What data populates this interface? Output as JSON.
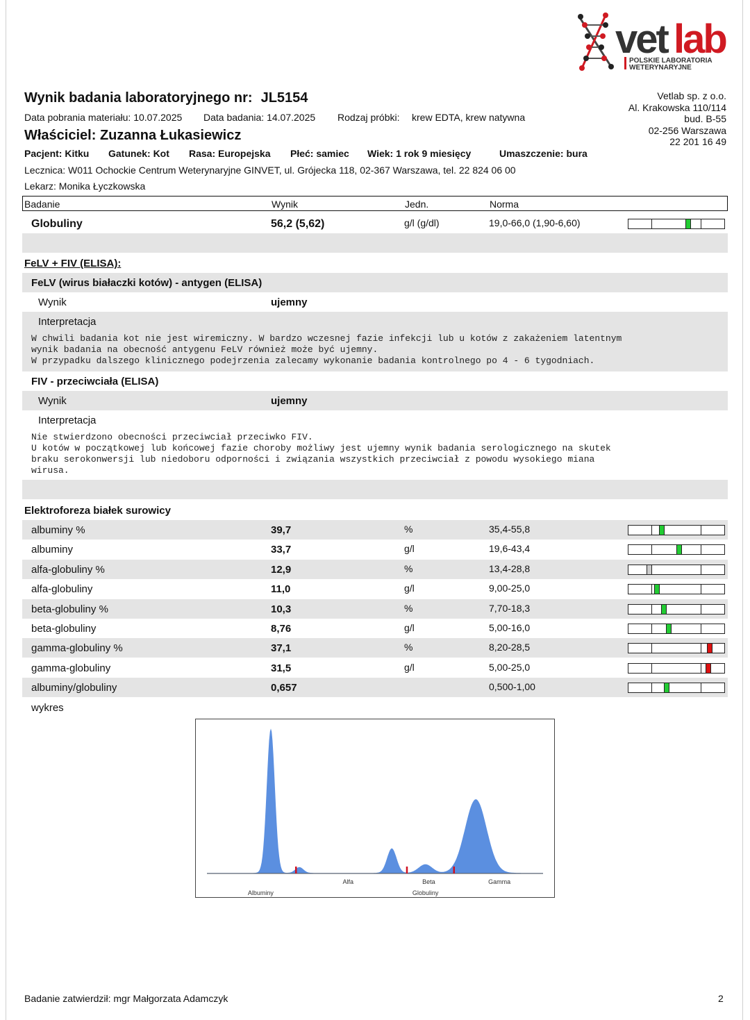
{
  "logo": {
    "brand_a": "vet",
    "brand_b": "lab",
    "line1": "POLSKIE LABORATORIA",
    "line2": "WETERYNARYJNE"
  },
  "report": {
    "title_label": "Wynik badania laboratoryjnego nr:",
    "number": "JL5154",
    "collection_date": "Data pobrania materiału: 10.07.2025",
    "test_date": "Data badania: 14.07.2025",
    "sample_type_label": "Rodzaj próbki:",
    "sample_type": "krew EDTA, krew natywna",
    "owner_label": "Właściciel:",
    "owner": "Zuzanna Łukasiewicz",
    "patient": "Pacjent: Kitku",
    "species": "Gatunek: Kot",
    "breed": "Rasa: Europejska",
    "sex": "Płeć: samiec",
    "age": "Wiek: 1 rok 9 miesięcy",
    "color": "Umaszczenie: bura",
    "clinic": "Lecznica: W011 Ochockie Centrum Weterynaryjne GINVET, ul. Grójecka 118, 02-367 Warszawa, tel. 22 824 06 00",
    "doctor": "Lekarz: Monika Łyczkowska"
  },
  "lab": {
    "name": "Vetlab sp. z o.o.",
    "street": "Al. Krakowska 110/114",
    "building": "bud. B-55",
    "city": "02-256 Warszawa",
    "phone": "22 201 16 49"
  },
  "table_header": {
    "test": "Badanie",
    "result": "Wynik",
    "unit": "Jedn.",
    "norm": "Norma"
  },
  "globulins": {
    "name": "Globuliny",
    "result": "56,2 (5,62)",
    "unit": "g/l (g/dl)",
    "norm": "19,0-66,0 (1,90-6,60)",
    "level": 0.62,
    "status": "normal"
  },
  "felv_fiv": {
    "heading": "FeLV + FIV (ELISA):",
    "felv_title": "FeLV (wirus białaczki kotów) - antygen (ELISA)",
    "felv_result_label": "Wynik",
    "felv_result": "ujemny",
    "felv_interp_label": "Interpretacja",
    "felv_interp": "W chwili badania kot nie jest wiremiczny. W bardzo wczesnej fazie infekcji lub u kotów z zakażeniem latentnym\nwynik badania na obecność antygenu FeLV również może być ujemny.\nW przypadku dalszego klinicznego podejrzenia zalecamy wykonanie badania kontrolnego po 4 - 6 tygodniach.",
    "fiv_title": "FIV - przeciwciała (ELISA)",
    "fiv_result_label": "Wynik",
    "fiv_result": "ujemny",
    "fiv_interp_label": "Interpretacja",
    "fiv_interp": "Nie stwierdzono obecności przeciwciał przeciwko FIV.\nU kotów w początkowej lub końcowej fazie choroby możliwy jest ujemny wynik badania serologicznego na skutek\nbraku serokonwersji lub niedoboru odporności i związania wszystkich przeciwciał z powodu wysokiego miana\nwirusa."
  },
  "electrophoresis": {
    "heading": "Elektroforeza białek surowicy",
    "rows": [
      {
        "name": "albuminy %",
        "result": "39,7",
        "unit": "%",
        "norm": "35,4-55,8",
        "level": 0.35,
        "status": "normal"
      },
      {
        "name": "albuminy",
        "result": "33,7",
        "unit": "g/l",
        "norm": "19,6-43,4",
        "level": 0.53,
        "status": "normal"
      },
      {
        "name": "alfa-globuliny %",
        "result": "12,9",
        "unit": "%",
        "norm": "13,4-28,8",
        "level": 0.22,
        "status": "low"
      },
      {
        "name": "alfa-globuliny",
        "result": "11,0",
        "unit": "g/l",
        "norm": "9,00-25,0",
        "level": 0.3,
        "status": "normal"
      },
      {
        "name": "beta-globuliny %",
        "result": "10,3",
        "unit": "%",
        "norm": "7,70-18,3",
        "level": 0.37,
        "status": "normal"
      },
      {
        "name": "beta-globuliny",
        "result": "8,76",
        "unit": "g/l",
        "norm": "5,00-16,0",
        "level": 0.42,
        "status": "normal"
      },
      {
        "name": "gamma-globuliny %",
        "result": "37,1",
        "unit": "%",
        "norm": "8,20-28,5",
        "level": 0.85,
        "status": "high"
      },
      {
        "name": "gamma-globuliny",
        "result": "31,5",
        "unit": "g/l",
        "norm": "5,00-25,0",
        "level": 0.83,
        "status": "high"
      },
      {
        "name": "albuminy/globuliny",
        "result": "0,657",
        "unit": "",
        "norm": "0,500-1,00",
        "level": 0.4,
        "status": "normal"
      }
    ]
  },
  "chart_label": "wykres",
  "chart_data": {
    "type": "area",
    "x_labels": [
      "Albuminy",
      "Alfa",
      "Globuliny",
      "Beta",
      "Gamma"
    ],
    "fraction_boundaries": [
      0.265,
      0.595,
      0.735
    ],
    "peaks": [
      {
        "fraction": "Albuminy",
        "position": 0.19,
        "relative_height": 1.0
      },
      {
        "fraction": "Alfa",
        "position": 0.275,
        "relative_height": 0.04
      },
      {
        "fraction": "Beta",
        "position": 0.55,
        "relative_height": 0.17
      },
      {
        "fraction": "Beta",
        "position": 0.65,
        "relative_height": 0.06
      },
      {
        "fraction": "Gamma",
        "position": 0.8,
        "relative_height": 0.51
      }
    ],
    "fill_color": "#5b8fe0",
    "marker_color": "#d01020"
  },
  "colors": {
    "normal": "#22cc33",
    "low": "#cccccc",
    "high": "#dd1111",
    "gray_band": "#e4e4e4"
  },
  "footer": {
    "approved": "Badanie zatwierdził: mgr Małgorzata Adamczyk",
    "page": "2"
  }
}
